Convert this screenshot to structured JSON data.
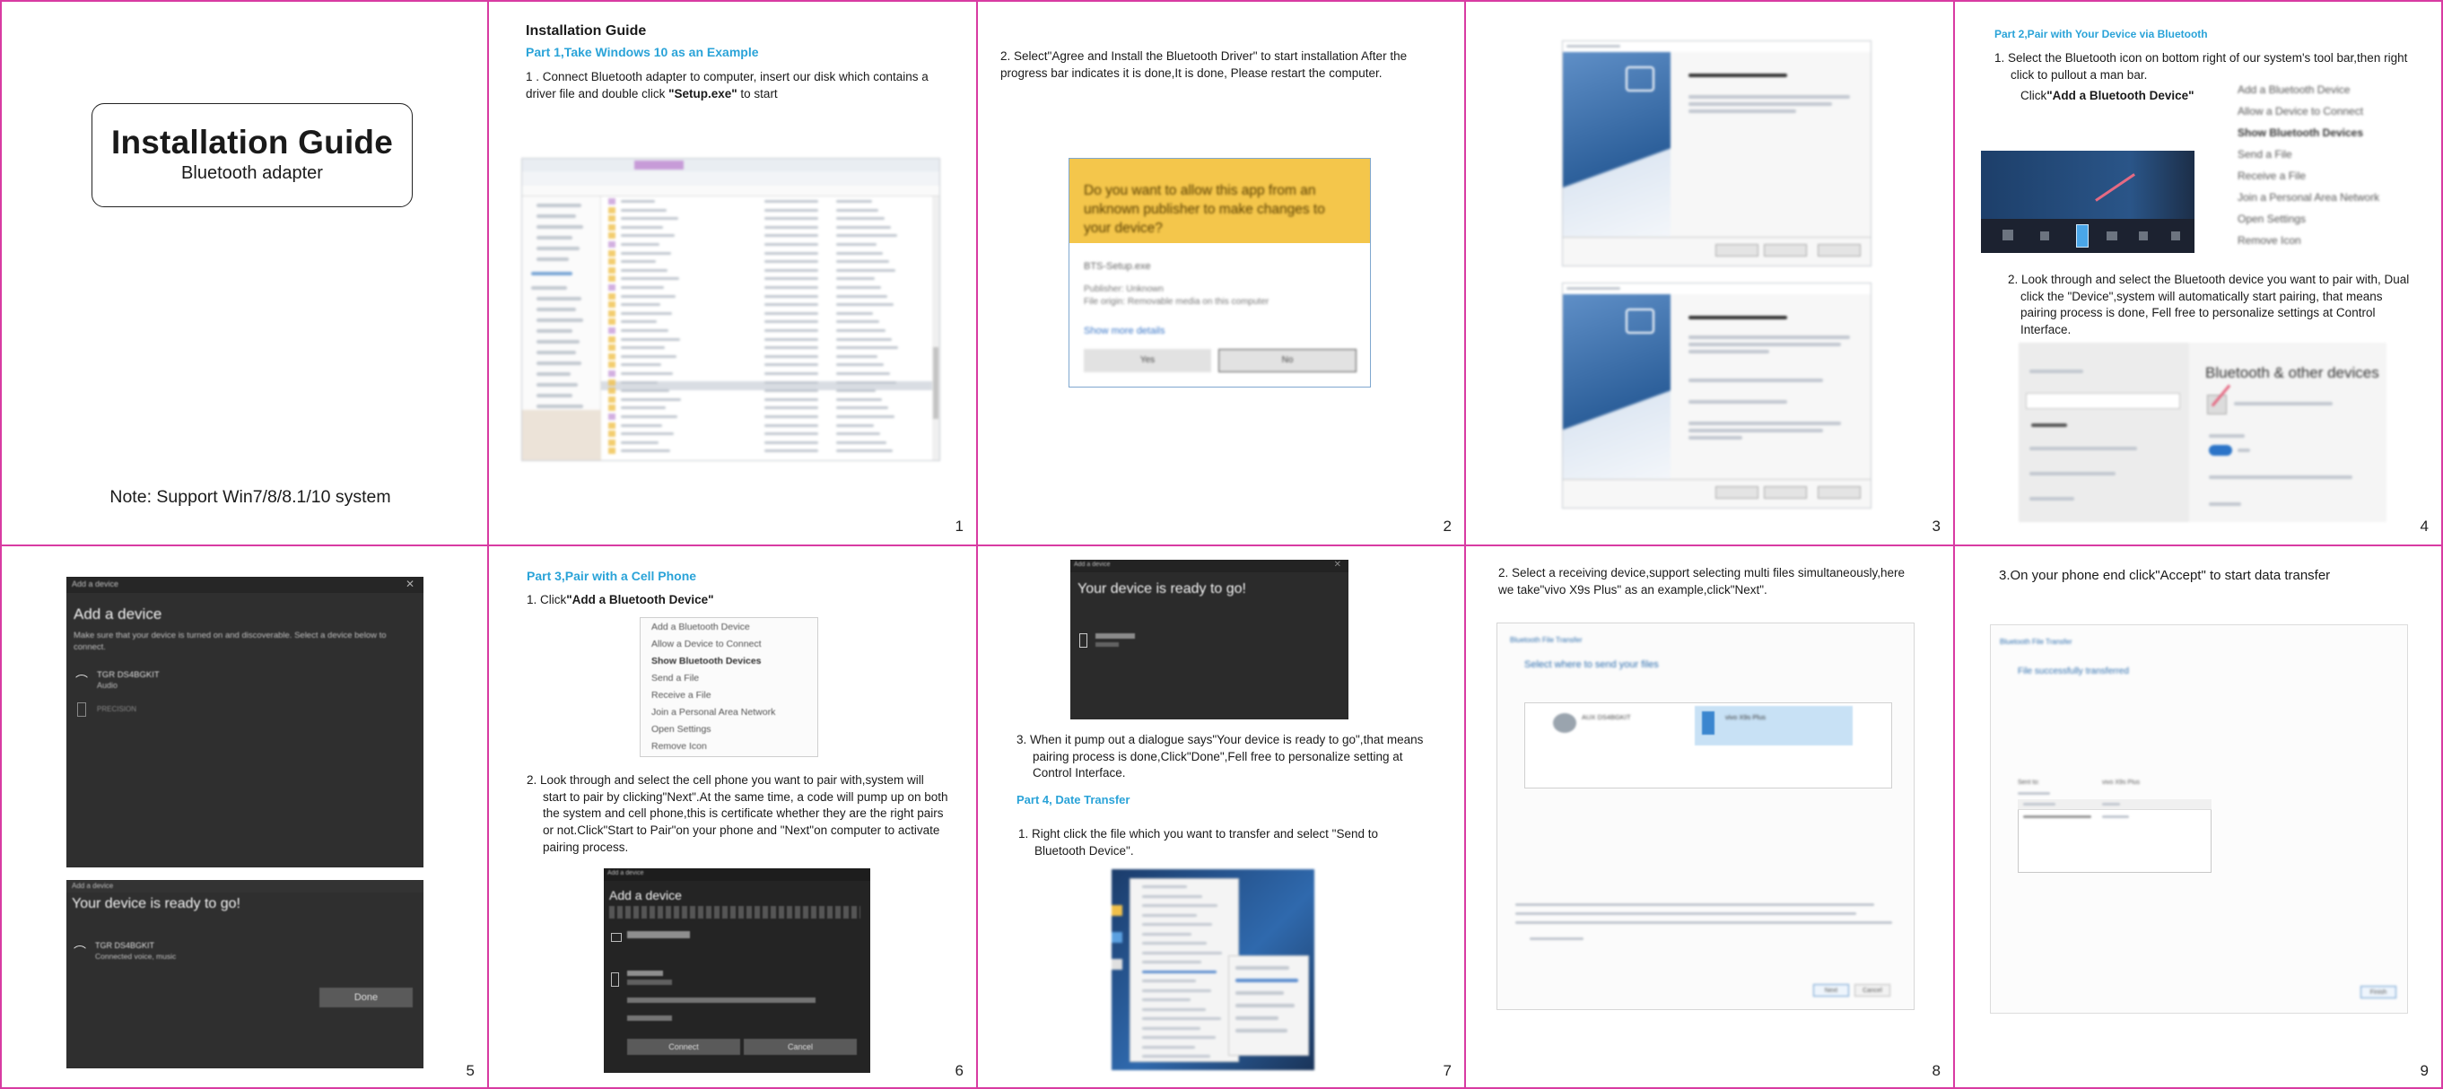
{
  "cover": {
    "title": "Installation Guide",
    "subtitle": "Bluetooth adapter",
    "note": "Note: Support Win7/8/8.1/10 system"
  },
  "p1": {
    "title": "Installation Guide",
    "part": "Part 1,Take Windows 10 as an Example",
    "text_a": "1 . Connect Bluetooth adapter to computer, insert our disk which contains a driver file and double click ",
    "text_b": "\"Setup.exe\"",
    "text_c": " to start",
    "num": "1"
  },
  "p2": {
    "text": "2. Select\"Agree and Install the Bluetooth Driver\" to start installation After the progress bar indicates it is done,It is done, Please restart the computer.",
    "uac_title": "Do you want to allow this app from an unknown publisher to make changes to your device?",
    "uac_file": "BTS-Setup.exe",
    "uac_publisher": "Publisher: Unknown",
    "uac_origin": "File origin: Removable media on this computer",
    "uac_more": "Show more details",
    "uac_yes": "Yes",
    "uac_no": "No",
    "num": "2"
  },
  "p3": {
    "num": "3"
  },
  "p4": {
    "part": "Part 2,Pair with Your Device via Bluetooth",
    "step1": "1. Select the Bluetooth icon on bottom right of our system's tool bar,then right click to pullout a man bar.",
    "click_prefix": "Click",
    "click_label": "\"Add a Bluetooth Device\"",
    "menu": [
      "Add a Bluetooth Device",
      "Allow a Device to Connect",
      "Show Bluetooth Devices",
      "Send a File",
      "Receive a File",
      "Join a Personal Area Network",
      "Open Settings",
      "Remove Icon"
    ],
    "step2": "2. Look through and select the Bluetooth device you want to pair with, Dual click the \"Device\",system will automatically start pairing, that means pairing process is done, Fell free to personalize settings at Control Interface.",
    "settings_heading": "Bluetooth & other devices",
    "num": "4"
  },
  "p5": {
    "dlg1_title": "Add a device",
    "dlg1_text": "Make sure that your device is turned on and discoverable. Select a device below to connect.",
    "dev1": "TGR DS4BGKIT",
    "dev1_sub": "Audio",
    "dev2": "PRECISION",
    "dlg2_title": "Your device is ready to go!",
    "dev3": "TGR DS4BGKIT",
    "dev3_sub": "Connected voice, music",
    "done_btn": "Done",
    "num": "5"
  },
  "p6": {
    "part": "Part 3,Pair with a Cell Phone",
    "step1_prefix": "1. Click",
    "step1_label": "\"Add a Bluetooth Device\"",
    "step2": "2. Look through and select the cell phone you want to pair with,system will start to pair by clicking\"Next\".At the same time, a code will pump up on both the system and cell phone,this is certificate whether they are the right pairs or not.Click\"Start to Pair\"on your phone and \"Next\"on computer to activate pairing process.",
    "dlg_title": "Add a device",
    "connect_btn": "Connect",
    "cancel_btn": "Cancel",
    "num": "6"
  },
  "p7": {
    "dlg_title": "Your device is ready to go!",
    "step3": "3. When it pump out a dialogue says\"Your device is ready to go\",that means pairing process is done,Click\"Done\",Fell free to personalize setting at Control Interface.",
    "part": "Part 4, Date Transfer",
    "step1": "1. Right click the file which you want to transfer and select \"Send to Bluetooth Device\".",
    "num": "7"
  },
  "p8": {
    "text": "2. Select a receiving device,support selecting multi files simultaneously,here we take\"vivo X9s Plus\" as an example,click\"Next\".",
    "win_title": "Bluetooth File Transfer",
    "heading": "Select where to send your files",
    "dev_a": "AUX DS4BGKIT",
    "dev_b": "vivo X9s Plus",
    "next_btn": "Next",
    "cancel_btn": "Cancel",
    "num": "8"
  },
  "p9": {
    "text": "3.On your phone end click\"Accept\" to start data transfer",
    "win_title": "Bluetooth File Transfer",
    "heading": "File successfully transferred",
    "sent_label": "Sent to:",
    "sent_value": "vivo X9s Plus",
    "finish_btn": "Finish",
    "num": "9"
  },
  "colors": {
    "border": "#d83ba2",
    "accent": "#2aa3d8"
  }
}
